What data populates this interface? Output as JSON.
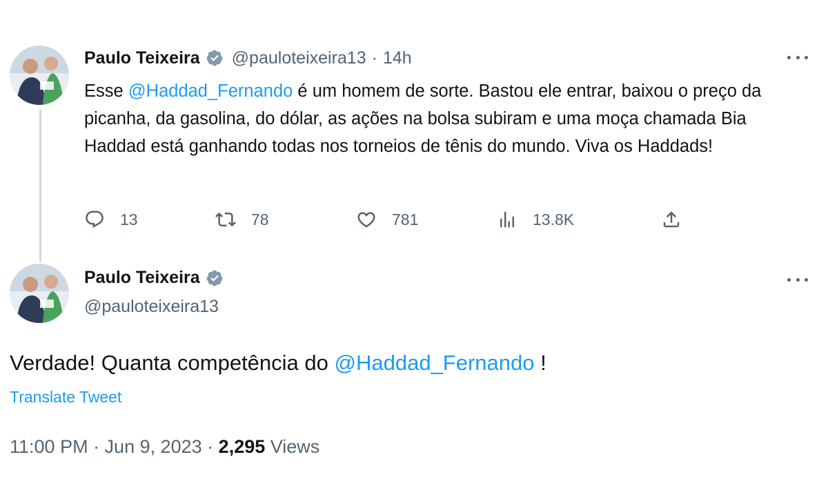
{
  "tweet1": {
    "author_name": "Paulo Teixeira",
    "handle": "@pauloteixeira13",
    "separator": "·",
    "time": "14h",
    "body_before": "Esse ",
    "mention": "@Haddad_Fernando",
    "body_after": " é um homem de sorte. Bastou ele entrar, baixou o preço da picanha, da gasolina, do dólar, as ações na bolsa subiram e uma moça chamada Bia Haddad está ganhando todas nos torneios de tênis do mundo. Viva os Haddads!",
    "replies": "13",
    "retweets": "78",
    "likes": "781",
    "views": "13.8K"
  },
  "tweet2": {
    "author_name": "Paulo Teixeira",
    "handle": "@pauloteixeira13",
    "body_before": "Verdade! Quanta competência do ",
    "mention": "@Haddad_Fernando",
    "body_after": " !",
    "translate_label": "Translate Tweet",
    "timestamp": "11:00 PM · Jun 9, 2023 · ",
    "views_count": "2,295",
    "views_label": " Views"
  },
  "colors": {
    "accent": "#1d9bf0",
    "text_primary": "#0f1419",
    "text_secondary": "#536471",
    "verified_badge": "#829aab"
  },
  "icons": {
    "verified": "verified-badge-icon",
    "reply": "reply-icon",
    "retweet": "retweet-icon",
    "like": "heart-icon",
    "views": "analytics-icon",
    "share": "share-icon",
    "more": "more-icon"
  }
}
